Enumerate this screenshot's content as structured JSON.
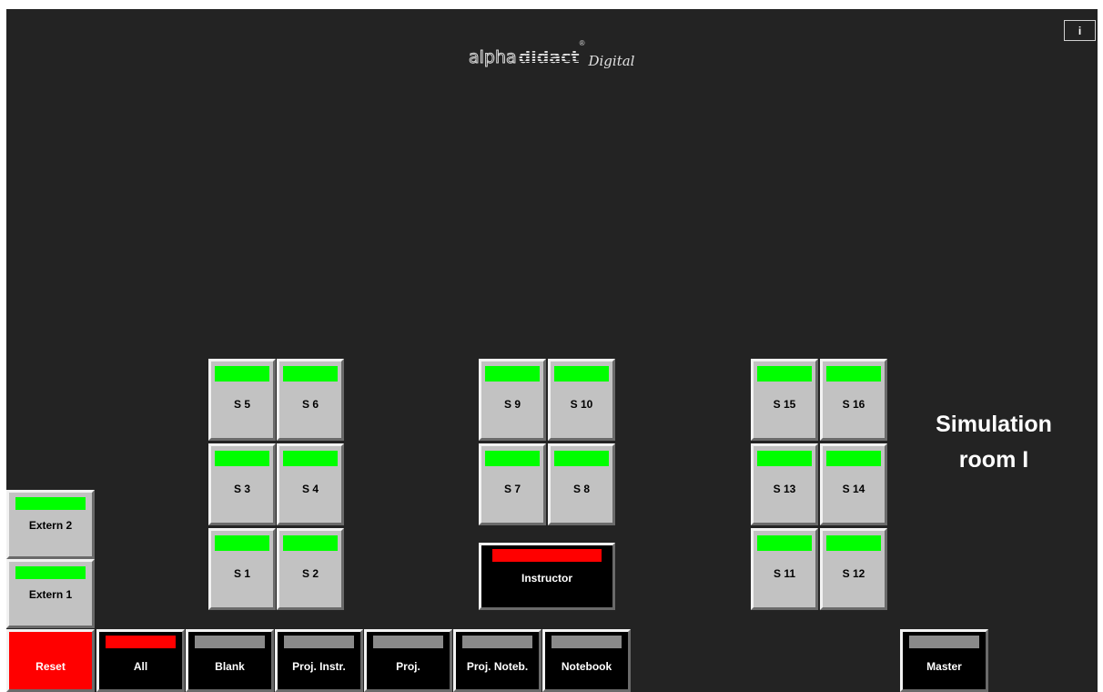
{
  "logo": {
    "alpha": "alpha",
    "didact": "didact",
    "reg": "®",
    "digital": "Digital"
  },
  "info_label": "i",
  "room_title": [
    "Simulation",
    "room I"
  ],
  "colors": {
    "green": "#00ff00",
    "red": "#ff0000",
    "gray": "#8a8a8a",
    "bg": "#232323"
  },
  "stations": {
    "s5": "S 5",
    "s6": "S 6",
    "s3": "S 3",
    "s4": "S 4",
    "s1": "S 1",
    "s2": "S 2",
    "s9": "S 9",
    "s10": "S 10",
    "s7": "S 7",
    "s8": "S 8",
    "s15": "S 15",
    "s16": "S 16",
    "s13": "S 13",
    "s14": "S 14",
    "s11": "S 11",
    "s12": "S 12"
  },
  "externals": {
    "extern2": "Extern 2",
    "extern1": "Extern 1"
  },
  "instructor": "Instructor",
  "bottom_bar": {
    "reset": "Reset",
    "all": "All",
    "blank": "Blank",
    "proj_instr": "Proj. Instr.",
    "proj": "Proj.",
    "proj_noteb": "Proj. Noteb.",
    "notebook": "Notebook",
    "master": "Master"
  }
}
